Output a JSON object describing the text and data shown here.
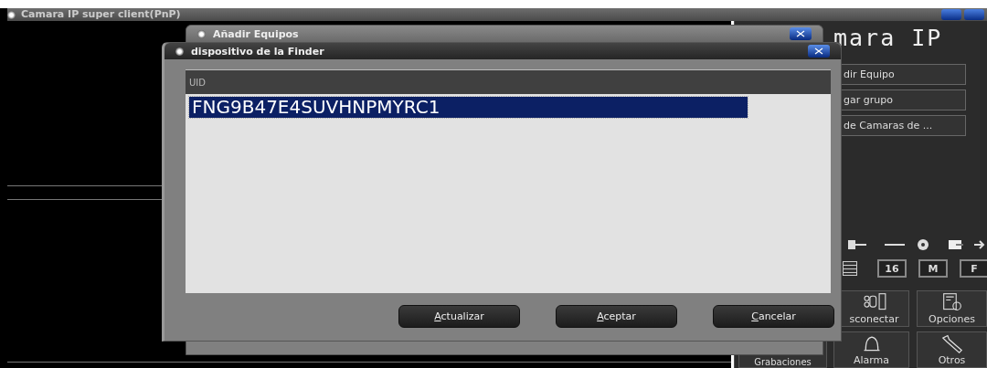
{
  "main_window": {
    "title": "Camara IP super client(PnP)",
    "app_title": "mara IP",
    "side_buttons": [
      "dir Equipo",
      "gar grupo",
      "de Camaras de ..."
    ],
    "view_buttons": [
      "16",
      "M",
      "F"
    ],
    "tiles": [
      {
        "label": "sconectar",
        "kind": "disconnect"
      },
      {
        "label": "Opciones",
        "kind": "options"
      },
      {
        "label": "Grabaciones",
        "kind": "recordings"
      },
      {
        "label": "Alarma",
        "kind": "alarm"
      },
      {
        "label": "Otros",
        "kind": "tools"
      }
    ]
  },
  "add_dialog": {
    "title": "Añadir Equipos"
  },
  "finder_dialog": {
    "title": "dispositivo de la Finder",
    "columns": [
      "UID"
    ],
    "rows": [
      {
        "uid": "FNG9B47E4SUVHNPMYRC1",
        "selected": true
      }
    ],
    "buttons": [
      "Actualizar",
      "Aceptar",
      "Cancelar"
    ]
  }
}
